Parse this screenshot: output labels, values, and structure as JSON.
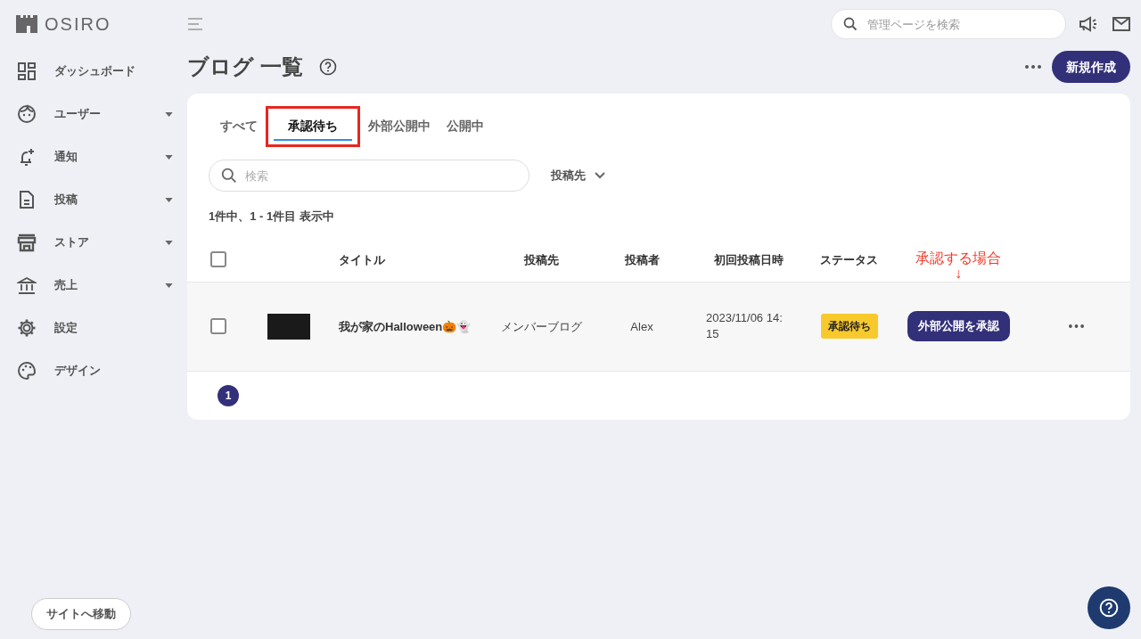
{
  "logo": {
    "text": "OSIRO"
  },
  "sidebar": {
    "items": [
      {
        "label": "ダッシュボード",
        "expandable": false
      },
      {
        "label": "ユーザー",
        "expandable": true
      },
      {
        "label": "通知",
        "expandable": true
      },
      {
        "label": "投稿",
        "expandable": true
      },
      {
        "label": "ストア",
        "expandable": true
      },
      {
        "label": "売上",
        "expandable": true
      },
      {
        "label": "設定",
        "expandable": false
      },
      {
        "label": "デザイン",
        "expandable": false
      }
    ],
    "site_button": "サイトへ移動"
  },
  "header": {
    "search_placeholder": "管理ページを検索"
  },
  "page": {
    "title": "ブログ 一覧",
    "new_button": "新規作成"
  },
  "tabs": [
    {
      "label": "すべて",
      "selected": false,
      "highlighted": false
    },
    {
      "label": "承認待ち",
      "selected": true,
      "highlighted": true
    },
    {
      "label": "外部公開中",
      "selected": false,
      "highlighted": false
    },
    {
      "label": "公開中",
      "selected": false,
      "highlighted": false
    }
  ],
  "filter": {
    "search_placeholder": "検索",
    "destination_dropdown": "投稿先"
  },
  "result_count": "1件中、1 - 1件目 表示中",
  "table": {
    "columns": [
      "タイトル",
      "投稿先",
      "投稿者",
      "初回投稿日時",
      "ステータス"
    ],
    "select_all_checked": false,
    "rows": [
      {
        "checked": false,
        "title": "我が家のHalloween🎃👻",
        "destination": "メンバーブログ",
        "author": "Alex",
        "date": "2023/11/06 14:\n15",
        "status": "承認待ち",
        "action": "外部公開を承認"
      }
    ]
  },
  "annotation": {
    "text": "承認する場合",
    "arrow": "↓"
  },
  "pagination": [
    {
      "label": "1",
      "selected": true
    }
  ]
}
